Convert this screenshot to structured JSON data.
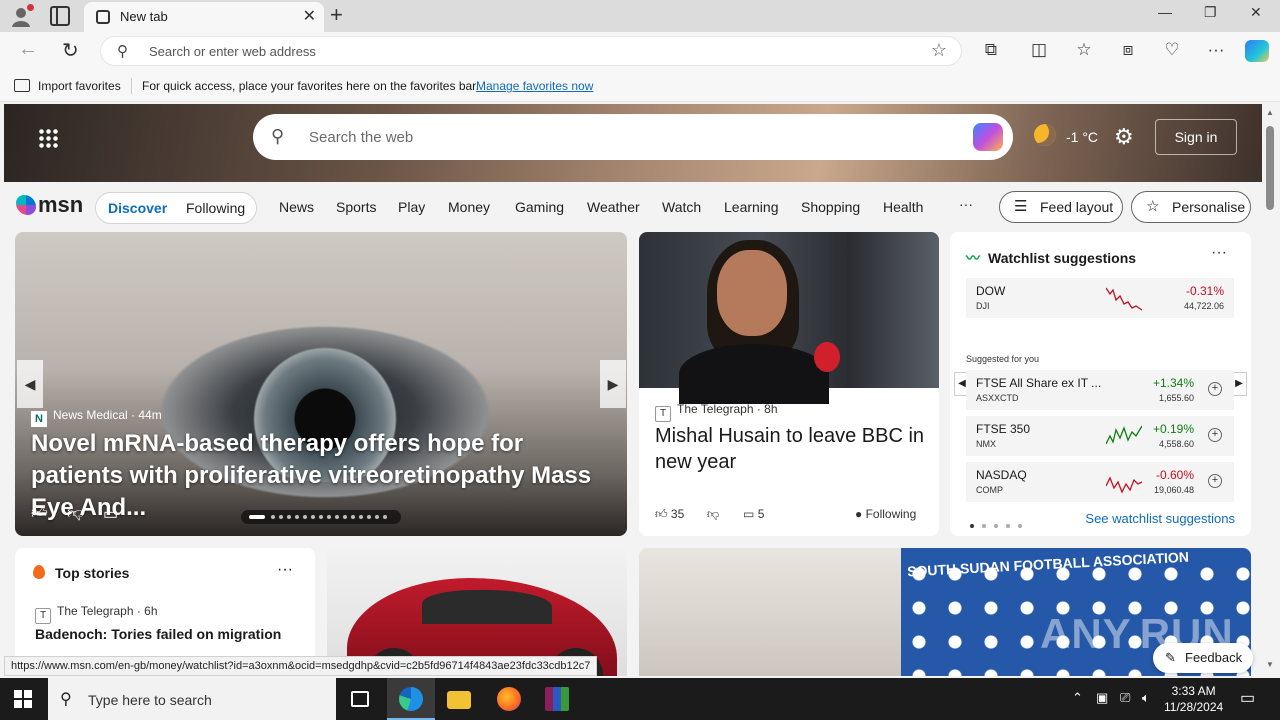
{
  "browser": {
    "tab_title": "New tab",
    "address_placeholder": "Search or enter web address",
    "favorites": {
      "import_label": "Import favorites",
      "hint": "For quick access, place your favorites here on the favorites bar.",
      "manage_link": "Manage favorites now"
    }
  },
  "hero": {
    "search_placeholder": "Search the web",
    "temperature": "-1 °C",
    "sign_in": "Sign in"
  },
  "nav": {
    "logo": "msn",
    "discover": "Discover",
    "following": "Following",
    "items": [
      "News",
      "Sports",
      "Play",
      "Money",
      "Gaming",
      "Weather",
      "Watch",
      "Learning",
      "Shopping",
      "Health"
    ],
    "more": "···",
    "feed_layout": "Feed layout",
    "personalise": "Personalise"
  },
  "carousel": {
    "source": "News Medical",
    "age": "· 44m",
    "headline": "Novel mRNA-based therapy offers hope for patients with proliferative vitreoretinopathy Mass Eye And...",
    "dot_count": 16,
    "active_dot": 0
  },
  "telegraph_card": {
    "source": "The Telegraph",
    "age": "· 8h",
    "title": "Mishal Husain to leave BBC in new year",
    "likes": "35",
    "comments": "5",
    "following": "Following"
  },
  "watchlist": {
    "title": "Watchlist suggestions",
    "more": "···",
    "pinned": {
      "name": "DOW",
      "symbol": "DJI",
      "change": "-0.31%",
      "price": "44,722.06",
      "direction": "down"
    },
    "suggested_label": "Suggested for you",
    "suggestions": [
      {
        "name": "FTSE All Share ex IT ...",
        "symbol": "ASXXCTD",
        "change": "+1.34%",
        "price": "1,655.60",
        "direction": "up"
      },
      {
        "name": "FTSE 350",
        "symbol": "NMX",
        "change": "+0.19%",
        "price": "4,558.60",
        "direction": "up"
      },
      {
        "name": "NASDAQ",
        "symbol": "COMP",
        "change": "-0.60%",
        "price": "19,060.48",
        "direction": "down"
      }
    ],
    "see_link": "See watchlist suggestions",
    "colors": {
      "up": "#107c10",
      "down": "#c50f1f"
    }
  },
  "top_stories": {
    "title": "Top stories",
    "more": "···",
    "source": "The Telegraph",
    "age": "· 6h",
    "headline": "Badenoch: Tories failed on migration"
  },
  "football_card": {
    "banner_text": "SOUTH SUDAN FOOTBALL ASSOCIATION"
  },
  "watermark": "ANY.RUN",
  "feedback": "Feedback",
  "status_url": "https://www.msn.com/en-gb/money/watchlist?id=a3oxnm&ocid=msedgdhp&cvid=c2b5fd96714f4843ae23fdc33cdb12c7",
  "taskbar": {
    "search_placeholder": "Type here to search",
    "time": "3:33 AM",
    "date": "11/28/2024"
  }
}
